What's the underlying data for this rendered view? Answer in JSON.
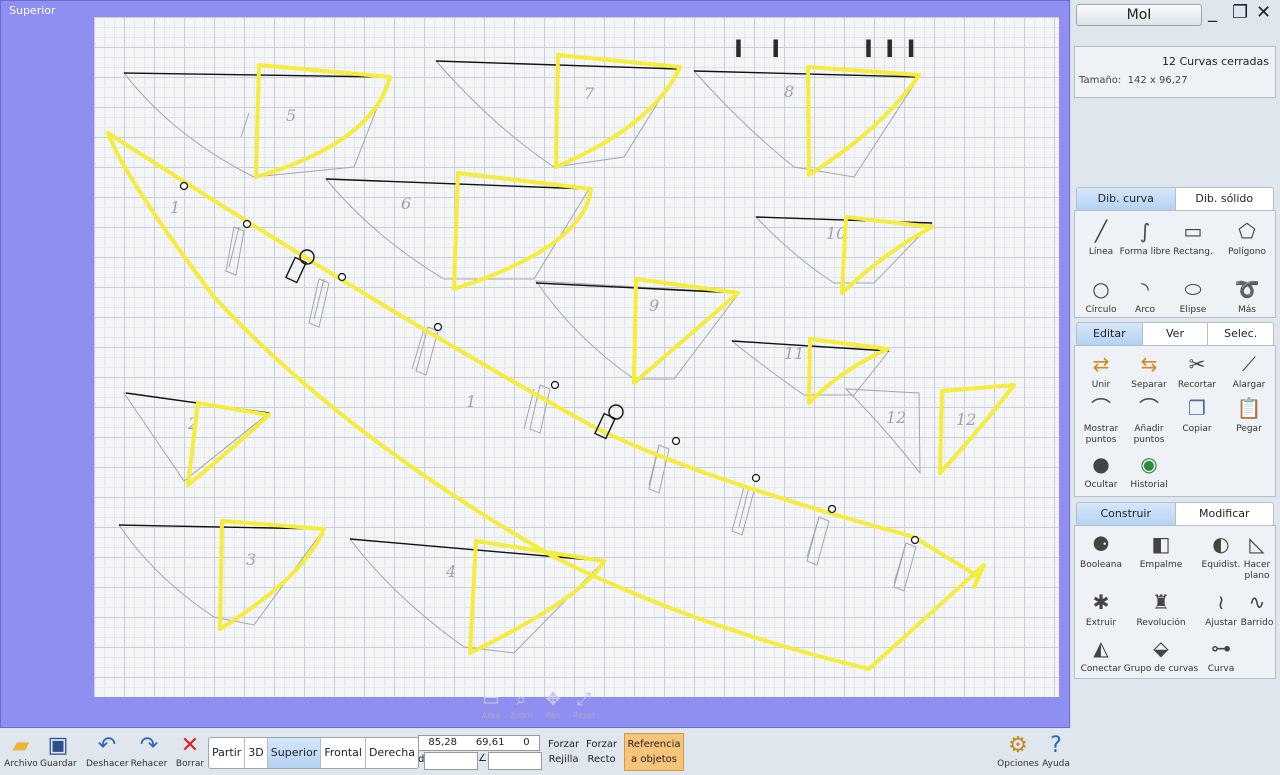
{
  "viewport": {
    "title": "Superior"
  },
  "canvas": {
    "sketch_numbers": [
      "5",
      "7",
      "8",
      "6",
      "10",
      "9",
      "11",
      "12",
      "2",
      "3",
      "4",
      "1",
      "1",
      "12"
    ],
    "tick_marks": [
      "I I",
      "I I I"
    ]
  },
  "nav": {
    "items": [
      "Área",
      "Zoom",
      "Pan",
      "Reset"
    ]
  },
  "app": {
    "title": "MoI",
    "minimize": "_",
    "maximize": "❐",
    "close": "✕"
  },
  "properties": {
    "selection": "12 Curvas cerradas",
    "size_label": "Tamaño:",
    "size_value": "142 x 96,27"
  },
  "tabs_draw": [
    {
      "label": "Dib. curva",
      "active": true
    },
    {
      "label": "Dib. sólido",
      "active": false
    }
  ],
  "tools_draw": [
    "Línea",
    "Forma libre",
    "Rectang.",
    "Polígono",
    "Círculo",
    "Arco",
    "Elipse",
    "Más"
  ],
  "tabs_edit": [
    {
      "label": "Editar",
      "active": true
    },
    {
      "label": "Ver",
      "active": false
    },
    {
      "label": "Selec.",
      "active": false
    }
  ],
  "tools_edit": [
    "Unir",
    "Separar",
    "Recortar",
    "Alargar",
    "Mostrar puntos",
    "Añadir puntos",
    "Copiar",
    "Pegar",
    "Ocultar",
    "Historial"
  ],
  "tabs_build": [
    {
      "label": "Construir",
      "active": true
    },
    {
      "label": "Modificar",
      "active": false
    }
  ],
  "tools_build": [
    "Booleana",
    "Empalme",
    "Equidist.",
    "Hacer plano",
    "Extruir",
    "Revolución",
    "Ajustar",
    "Barrido",
    "Conectar",
    "Grupo de curvas",
    "Curva"
  ],
  "toolbar": {
    "archivo": "Archivo",
    "guardar": "Guardar",
    "deshacer": "Deshacer",
    "rehacer": "Rehacer",
    "borrar": "Borrar",
    "views": [
      {
        "label": "Partir",
        "active": false
      },
      {
        "label": "3D",
        "active": false
      },
      {
        "label": "Superior",
        "active": true
      },
      {
        "label": "Frontal",
        "active": false
      },
      {
        "label": "Derecha",
        "active": false
      }
    ],
    "coord_x": "85,28",
    "coord_y": "69,61",
    "coord_z": "0",
    "dist_label": "d",
    "angle_label": "∠",
    "forzar_rejilla": [
      "Forzar",
      "Rejilla"
    ],
    "forzar_recto": [
      "Forzar",
      "Recto"
    ],
    "referencia": [
      "Referencia",
      "a objetos"
    ],
    "opciones": "Opciones",
    "ayuda": "Ayuda"
  },
  "colors": {
    "curve": "#f5ec3b",
    "viewport_border": "#8f8ff2",
    "sketch": "#9a9ca2"
  }
}
